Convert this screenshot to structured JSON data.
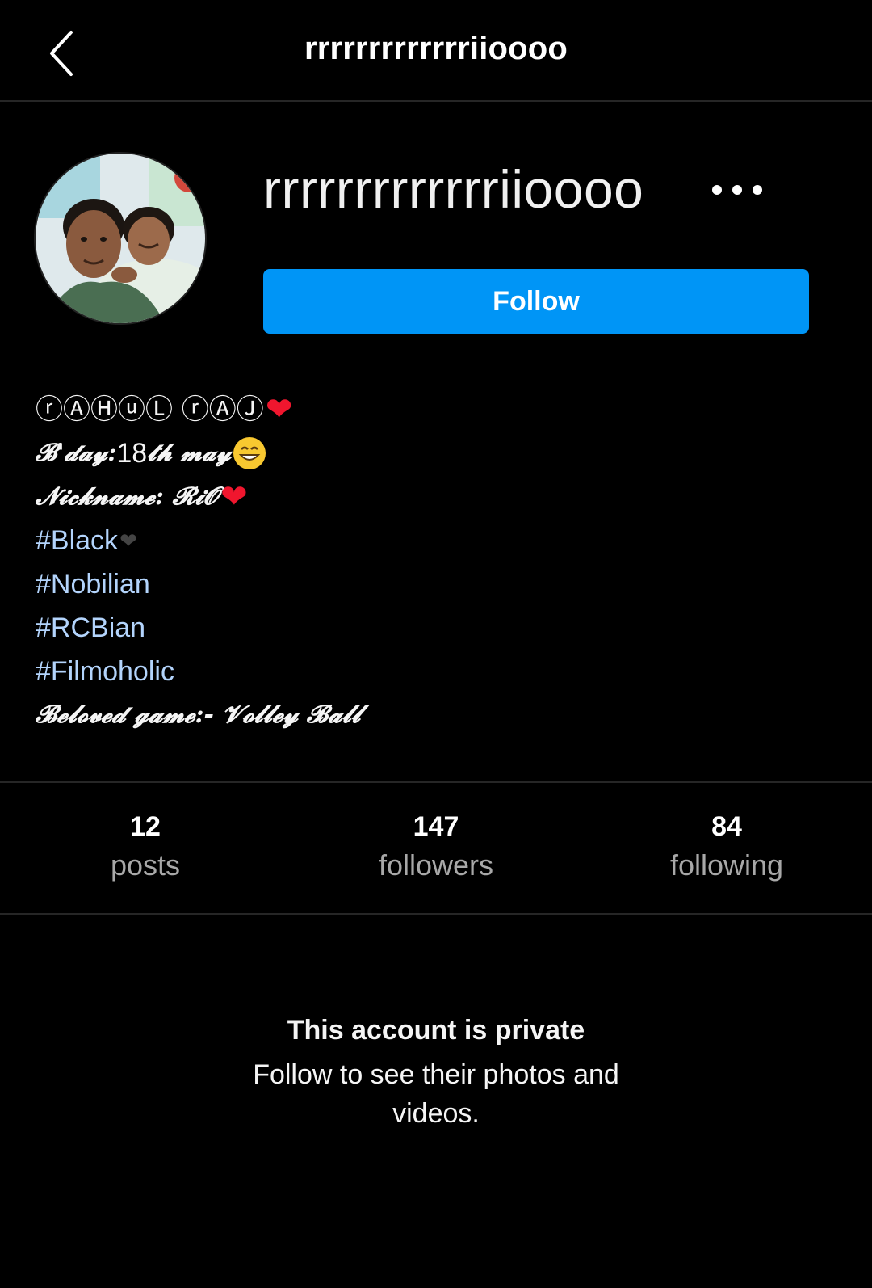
{
  "header": {
    "title": "rrrrrrrrrrrrriioooo",
    "back_icon": "chevron-left-icon"
  },
  "profile": {
    "handle": "rrrrrrrrrrrrriioooo",
    "more_icon": "more-horizontal-icon",
    "follow_label": "Follow",
    "accent_color": "#0095f6"
  },
  "bio": {
    "name": "ⓡⒶⒽⓤⓁ ⓡⒶⒿ",
    "bday_label": "𝓑'𝓭𝓪𝔂:",
    "bday_value": "18",
    "bday_suffix": "𝓽𝓱 𝓶𝓪𝔂",
    "nickname": "𝓝𝓲𝓬𝓴𝓷𝓪𝓶𝓮: 𝓡𝓲𝓞",
    "tags": [
      "#Black",
      "#Nobilian",
      "#RCBian",
      "#Filmoholic"
    ],
    "game": "𝓑𝓮𝓵𝓸𝓿𝓮𝓭 𝓰𝓪𝓶𝓮:- 𝓥𝓸𝓵𝓵𝓮𝔂 𝓑𝓪𝓵𝓵"
  },
  "stats": [
    {
      "value": "12",
      "label": "posts"
    },
    {
      "value": "147",
      "label": "followers"
    },
    {
      "value": "84",
      "label": "following"
    }
  ],
  "private": {
    "title": "This account is private",
    "subtitle": "Follow to see their photos and videos."
  }
}
